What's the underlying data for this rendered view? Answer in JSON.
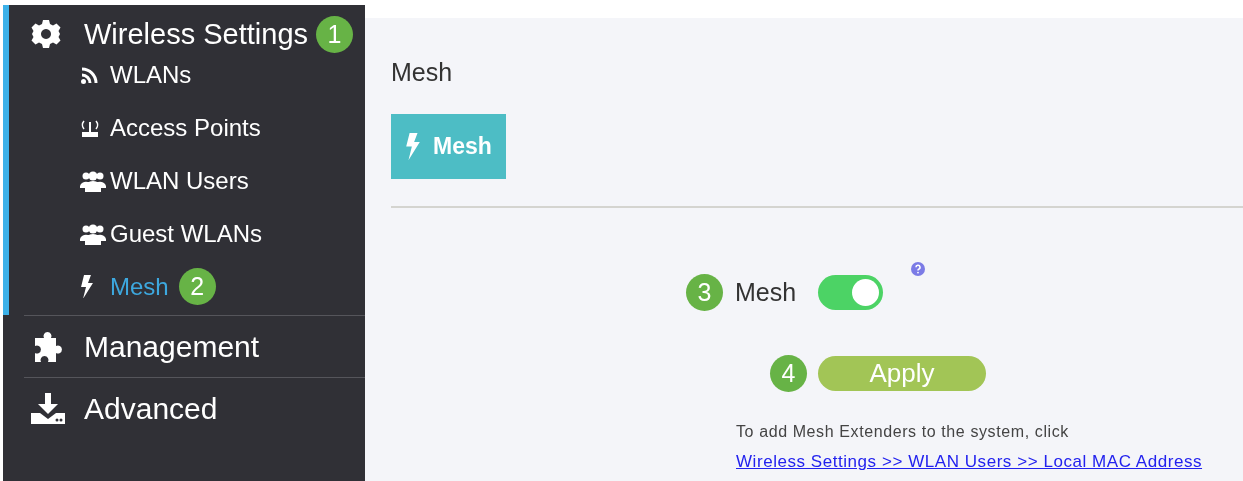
{
  "sidebar": {
    "sections": [
      {
        "label": "Wireless Settings",
        "kind": "gear",
        "expanded": true,
        "callout": "1",
        "children": [
          {
            "label": "WLANs",
            "kind": "rss",
            "selected": false
          },
          {
            "label": "Access Points",
            "kind": "antenna",
            "selected": false
          },
          {
            "label": "WLAN Users",
            "kind": "users",
            "selected": false
          },
          {
            "label": "Guest WLANs",
            "kind": "users",
            "selected": false
          },
          {
            "label": "Mesh",
            "kind": "bolt",
            "selected": true,
            "callout": "2"
          }
        ]
      },
      {
        "label": "Management",
        "kind": "puzzle",
        "expanded": false
      },
      {
        "label": "Advanced",
        "kind": "download",
        "expanded": false
      }
    ]
  },
  "page": {
    "title": "Mesh",
    "tabs": [
      {
        "label": "Mesh",
        "kind": "bolt",
        "selected": true
      }
    ],
    "mesh_toggle": {
      "label": "Mesh",
      "on": true,
      "callout": "3"
    },
    "apply_button": {
      "label": "Apply",
      "callout": "4"
    },
    "note": "To add Mesh Extenders to the system, click",
    "link": "Wireless Settings >> WLAN Users >> Local MAC Address"
  }
}
